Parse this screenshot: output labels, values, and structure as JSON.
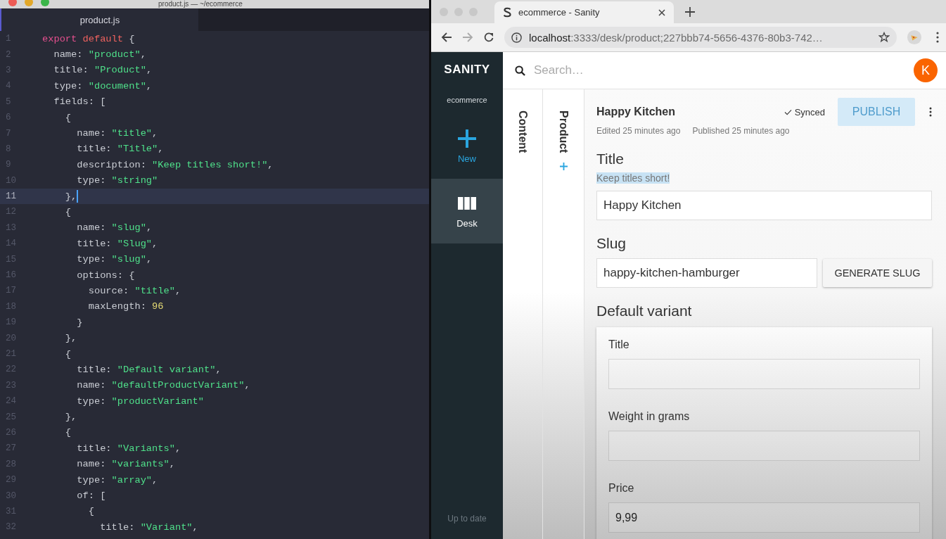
{
  "editor": {
    "window_title": "product.js — ~/ecommerce",
    "tabs": [
      {
        "label": "product.js",
        "selected": true
      }
    ],
    "lines": [
      {
        "number": "1",
        "current": false,
        "tokens": [
          {
            "kind": "keyword",
            "text": "export"
          },
          {
            "kind": "storage",
            "text": " default"
          },
          {
            "kind": "plain",
            "text": " {"
          }
        ]
      },
      {
        "number": "2",
        "current": false,
        "tokens": [
          {
            "kind": "plain",
            "text": "  name: "
          },
          {
            "kind": "string",
            "text": "\"product\""
          },
          {
            "kind": "plain",
            "text": ","
          }
        ]
      },
      {
        "number": "3",
        "current": false,
        "tokens": [
          {
            "kind": "plain",
            "text": "  title: "
          },
          {
            "kind": "string",
            "text": "\"Product\""
          },
          {
            "kind": "plain",
            "text": ","
          }
        ]
      },
      {
        "number": "4",
        "current": false,
        "tokens": [
          {
            "kind": "plain",
            "text": "  type: "
          },
          {
            "kind": "string",
            "text": "\"document\""
          },
          {
            "kind": "plain",
            "text": ","
          }
        ]
      },
      {
        "number": "5",
        "current": false,
        "tokens": [
          {
            "kind": "plain",
            "text": "  fields: ["
          }
        ]
      },
      {
        "number": "6",
        "current": false,
        "tokens": [
          {
            "kind": "plain",
            "text": "    {"
          }
        ]
      },
      {
        "number": "7",
        "current": false,
        "tokens": [
          {
            "kind": "plain",
            "text": "      name: "
          },
          {
            "kind": "string",
            "text": "\"title\""
          },
          {
            "kind": "plain",
            "text": ","
          }
        ]
      },
      {
        "number": "8",
        "current": false,
        "tokens": [
          {
            "kind": "plain",
            "text": "      title: "
          },
          {
            "kind": "string",
            "text": "\"Title\""
          },
          {
            "kind": "plain",
            "text": ","
          }
        ]
      },
      {
        "number": "9",
        "current": false,
        "tokens": [
          {
            "kind": "plain",
            "text": "      description: "
          },
          {
            "kind": "string",
            "text": "\"Keep titles short!\""
          },
          {
            "kind": "plain",
            "text": ","
          }
        ]
      },
      {
        "number": "10",
        "current": false,
        "tokens": [
          {
            "kind": "plain",
            "text": "      type: "
          },
          {
            "kind": "string",
            "text": "\"string\""
          }
        ]
      },
      {
        "number": "11",
        "current": true,
        "tokens": [
          {
            "kind": "plain",
            "text": "    },"
          }
        ]
      },
      {
        "number": "12",
        "current": false,
        "tokens": [
          {
            "kind": "plain",
            "text": "    {"
          }
        ]
      },
      {
        "number": "13",
        "current": false,
        "tokens": [
          {
            "kind": "plain",
            "text": "      name: "
          },
          {
            "kind": "string",
            "text": "\"slug\""
          },
          {
            "kind": "plain",
            "text": ","
          }
        ]
      },
      {
        "number": "14",
        "current": false,
        "tokens": [
          {
            "kind": "plain",
            "text": "      title: "
          },
          {
            "kind": "string",
            "text": "\"Slug\""
          },
          {
            "kind": "plain",
            "text": ","
          }
        ]
      },
      {
        "number": "15",
        "current": false,
        "tokens": [
          {
            "kind": "plain",
            "text": "      type: "
          },
          {
            "kind": "string",
            "text": "\"slug\""
          },
          {
            "kind": "plain",
            "text": ","
          }
        ]
      },
      {
        "number": "16",
        "current": false,
        "tokens": [
          {
            "kind": "plain",
            "text": "      options: {"
          }
        ]
      },
      {
        "number": "17",
        "current": false,
        "tokens": [
          {
            "kind": "plain",
            "text": "        source: "
          },
          {
            "kind": "string",
            "text": "\"title\""
          },
          {
            "kind": "plain",
            "text": ","
          }
        ]
      },
      {
        "number": "18",
        "current": false,
        "tokens": [
          {
            "kind": "plain",
            "text": "        maxLength: "
          },
          {
            "kind": "number",
            "text": "96"
          }
        ]
      },
      {
        "number": "19",
        "current": false,
        "tokens": [
          {
            "kind": "plain",
            "text": "      }"
          }
        ]
      },
      {
        "number": "20",
        "current": false,
        "tokens": [
          {
            "kind": "plain",
            "text": "    },"
          }
        ]
      },
      {
        "number": "21",
        "current": false,
        "tokens": [
          {
            "kind": "plain",
            "text": "    {"
          }
        ]
      },
      {
        "number": "22",
        "current": false,
        "tokens": [
          {
            "kind": "plain",
            "text": "      title: "
          },
          {
            "kind": "string",
            "text": "\"Default variant\""
          },
          {
            "kind": "plain",
            "text": ","
          }
        ]
      },
      {
        "number": "23",
        "current": false,
        "tokens": [
          {
            "kind": "plain",
            "text": "      name: "
          },
          {
            "kind": "string",
            "text": "\"defaultProductVariant\""
          },
          {
            "kind": "plain",
            "text": ","
          }
        ]
      },
      {
        "number": "24",
        "current": false,
        "tokens": [
          {
            "kind": "plain",
            "text": "      type: "
          },
          {
            "kind": "string",
            "text": "\"productVariant\""
          }
        ]
      },
      {
        "number": "25",
        "current": false,
        "tokens": [
          {
            "kind": "plain",
            "text": "    },"
          }
        ]
      },
      {
        "number": "26",
        "current": false,
        "tokens": [
          {
            "kind": "plain",
            "text": "    {"
          }
        ]
      },
      {
        "number": "27",
        "current": false,
        "tokens": [
          {
            "kind": "plain",
            "text": "      title: "
          },
          {
            "kind": "string",
            "text": "\"Variants\""
          },
          {
            "kind": "plain",
            "text": ","
          }
        ]
      },
      {
        "number": "28",
        "current": false,
        "tokens": [
          {
            "kind": "plain",
            "text": "      name: "
          },
          {
            "kind": "string",
            "text": "\"variants\""
          },
          {
            "kind": "plain",
            "text": ","
          }
        ]
      },
      {
        "number": "29",
        "current": false,
        "tokens": [
          {
            "kind": "plain",
            "text": "      type: "
          },
          {
            "kind": "string",
            "text": "\"array\""
          },
          {
            "kind": "plain",
            "text": ","
          }
        ]
      },
      {
        "number": "30",
        "current": false,
        "tokens": [
          {
            "kind": "plain",
            "text": "      of: ["
          }
        ]
      },
      {
        "number": "31",
        "current": false,
        "tokens": [
          {
            "kind": "plain",
            "text": "        {"
          }
        ]
      },
      {
        "number": "32",
        "current": false,
        "tokens": [
          {
            "kind": "plain",
            "text": "          title: "
          },
          {
            "kind": "string",
            "text": "\"Variant\""
          },
          {
            "kind": "plain",
            "text": ","
          }
        ]
      }
    ]
  },
  "browser": {
    "tabs": [
      {
        "title": "ecommerce - Sanity",
        "selected": true
      }
    ],
    "url_host": "localhost",
    "url_path": ":3333/desk/product;227bbb74-5656-4376-80b3-742…"
  },
  "studio": {
    "logo": "SANITY",
    "project": "ecommerce",
    "nav": [
      {
        "kind": "new",
        "label": "New",
        "selected": false
      },
      {
        "kind": "desk",
        "label": "Desk",
        "selected": true
      }
    ],
    "status": "Up to date",
    "search": {
      "placeholder": "Search…"
    },
    "avatar": "K",
    "panes": [
      {
        "kind": "list",
        "title": "Content"
      },
      {
        "kind": "type",
        "title": "Product"
      }
    ],
    "document": {
      "title": "Happy Kitchen",
      "sync": "Synced",
      "publish": {
        "label": "PUBLISH",
        "disabled": true
      },
      "meta": [
        "Edited 25 minutes ago",
        "Published 25 minutes ago"
      ],
      "fields": [
        {
          "kind": "string",
          "label": "Title",
          "description": "Keep titles short!",
          "description_highlighted": true,
          "value": "Happy Kitchen"
        },
        {
          "kind": "slug",
          "label": "Slug",
          "value": "happy-kitchen-hamburger",
          "button": "GENERATE SLUG"
        },
        {
          "kind": "object",
          "label": "Default variant",
          "fields": [
            {
              "label": "Title"
            },
            {
              "label": "Weight in grams"
            },
            {
              "label": "Price",
              "value": "9,99"
            }
          ]
        }
      ]
    }
  }
}
